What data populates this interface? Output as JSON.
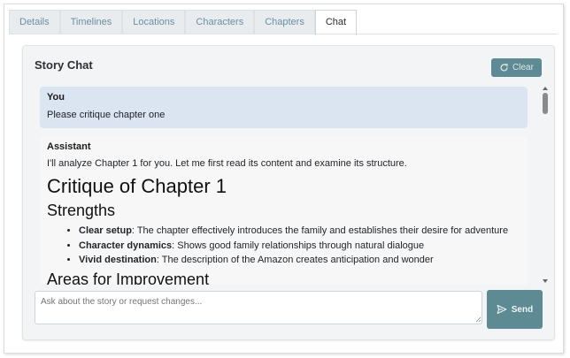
{
  "tabs": [
    {
      "label": "Details"
    },
    {
      "label": "Timelines"
    },
    {
      "label": "Locations"
    },
    {
      "label": "Characters"
    },
    {
      "label": "Chapters"
    },
    {
      "label": "Chat"
    }
  ],
  "active_tab": "Chat",
  "chat": {
    "title": "Story Chat",
    "clear_label": "Clear",
    "clear_icon": "refresh-icon",
    "messages": [
      {
        "role": "You",
        "text": "Please critique chapter one"
      },
      {
        "role": "Assistant",
        "text": "I'll analyze Chapter 1 for you. Let me first read its content and examine its structure.",
        "heading": "Critique of Chapter 1",
        "subheading": "Strengths",
        "points": [
          {
            "term": "Clear setup",
            "detail": ": The chapter effectively introduces the family and establishes their desire for adventure"
          },
          {
            "term": "Character dynamics",
            "detail": ": Shows good family relationships through natural dialogue"
          },
          {
            "term": "Vivid destination",
            "detail": ": The description of the Amazon creates anticipation and wonder"
          }
        ],
        "next_heading": "Areas for Improvement"
      }
    ],
    "input_placeholder": "Ask about the story or request changes...",
    "send_label": "Send",
    "send_icon": "send-icon"
  },
  "colors": {
    "accent": "#5e8a94",
    "user_bubble": "#dbe4f1",
    "tab_text": "#6c8ea2"
  }
}
